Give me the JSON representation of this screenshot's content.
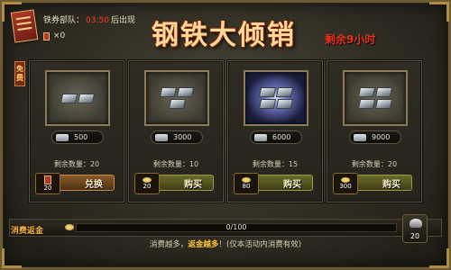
{
  "header": {
    "reset_prefix": "铁券部队：",
    "timer": "03:50",
    "reset_suffix": "后出现",
    "ticket_count": "×0",
    "title": "钢铁大倾销",
    "time_remaining": "剩余9小时"
  },
  "side_label": "免费",
  "items": [
    {
      "price": "500",
      "remaining": "剩余数量：20",
      "cost": "20",
      "button": "兑换",
      "currency": "ticket"
    },
    {
      "price": "3000",
      "remaining": "剩余数量：10",
      "cost": "20",
      "button": "购买",
      "currency": "gold"
    },
    {
      "price": "6000",
      "remaining": "剩余数量：15",
      "cost": "80",
      "button": "购买",
      "currency": "gold"
    },
    {
      "price": "9000",
      "remaining": "剩余数量：20",
      "cost": "300",
      "button": "购买",
      "currency": "gold"
    }
  ],
  "rebate": {
    "label": "消费返金",
    "progress_text": "0/100",
    "progress_fraction": 0,
    "note_prefix": "消费越多，",
    "note_highlight": "返金越多",
    "note_suffix": "！(仅本活动内消费有效)",
    "chest_count": "20"
  },
  "colors": {
    "title": "#ffd89a",
    "timer": "#ff3b2f",
    "highlight": "#ffc43a"
  }
}
